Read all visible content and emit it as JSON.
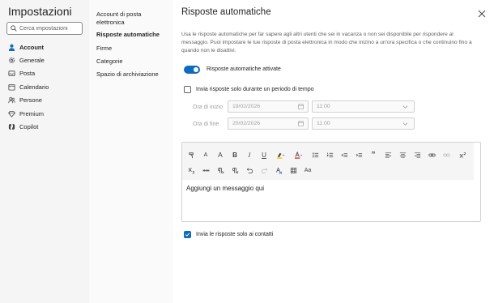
{
  "app": {
    "title": "Impostazioni"
  },
  "search": {
    "placeholder": "Cerca impostazioni"
  },
  "nav": {
    "items": [
      {
        "label": "Account",
        "icon": "person-icon",
        "active": true
      },
      {
        "label": "Generale",
        "icon": "gear-icon"
      },
      {
        "label": "Posta",
        "icon": "mail-icon"
      },
      {
        "label": "Calendario",
        "icon": "calendar-icon"
      },
      {
        "label": "Persone",
        "icon": "people-icon"
      },
      {
        "label": "Premium",
        "icon": "diamond-icon"
      },
      {
        "label": "Copilot",
        "icon": "copilot-icon"
      }
    ]
  },
  "subnav": {
    "items": [
      {
        "label": "Account di posta elettronica"
      },
      {
        "label": "Risposte automatiche",
        "active": true
      },
      {
        "label": "Firme"
      },
      {
        "label": "Categorie"
      },
      {
        "label": "Spazio di archiviazione"
      }
    ]
  },
  "main": {
    "title": "Risposte automatiche",
    "description": "Usa le risposte automatiche per far sapere agli altri utenti che sei in vacanza o non sei disponibile per rispondere al messaggio. Puoi impostare le tue risposte di posta elettronica in modo che inizino a un'ora specifica o che continuino fino a quando non le disattivi.",
    "toggle": {
      "label": "Risposte automatiche attivate",
      "on": true
    },
    "period_checkbox": {
      "label": "Invia risposte solo durante un periodo di tempo",
      "checked": false
    },
    "start": {
      "label": "Ora di inizio",
      "date": "19/02/2026",
      "time": "11:00"
    },
    "end": {
      "label": "Ora di fine",
      "date": "20/02/2026",
      "time": "11:00"
    },
    "editor": {
      "body": "Aggiungi un messaggio qui"
    },
    "contacts_checkbox": {
      "label": "Invia le risposte solo ai contatti",
      "checked": true
    }
  },
  "toolbar": {
    "buttons": [
      "format-painter-icon",
      "font-size-decrease-icon",
      "font-size-increase-icon",
      "bold-icon",
      "italic-icon",
      "underline-icon",
      "highlight-icon",
      "font-color-icon",
      "bullets-icon",
      "numbering-icon",
      "outdent-icon",
      "indent-icon",
      "quote-icon",
      "align-left-icon",
      "align-center-icon",
      "align-right-icon",
      "link-icon",
      "unlink-icon",
      "superscript-icon",
      "subscript-icon",
      "strikethrough-icon",
      "ltr-icon",
      "rtl-icon",
      "undo-icon",
      "redo-icon",
      "clear-format-icon",
      "table-icon",
      "change-case-icon"
    ],
    "labels": {
      "font_small": "A",
      "font_large": "A",
      "bold": "B",
      "italic": "I",
      "underline": "U",
      "quote": "”",
      "change_case": "Aa"
    }
  },
  "colors": {
    "accent": "#0f6cbd",
    "nav_bg": "#f5f5f5",
    "subnav_bg": "#fafafa",
    "highlight": "#f7c300",
    "font_color": "#d13438"
  }
}
